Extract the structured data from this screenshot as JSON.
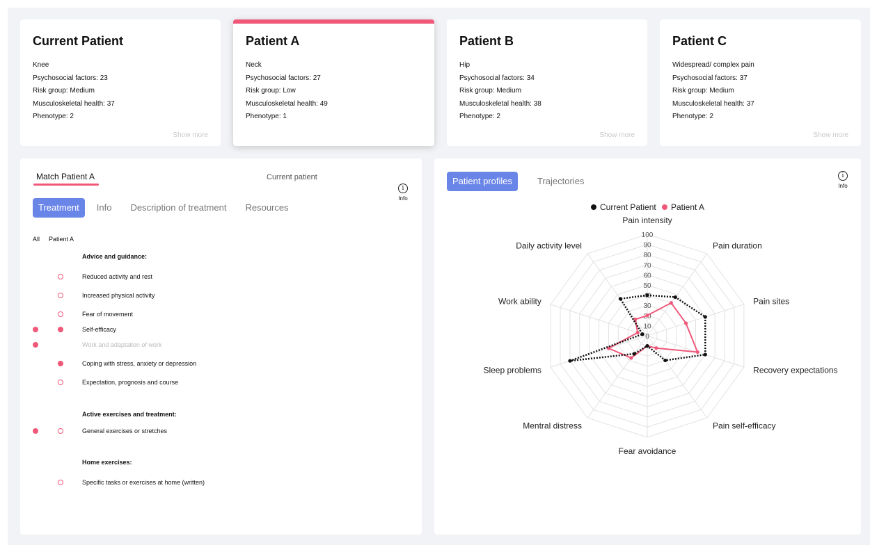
{
  "cards": [
    {
      "title": "Current Patient",
      "location": "Knee",
      "psychosocial": "Psychosocial factors: 23",
      "risk": "Risk group: Medium",
      "msk": "Musculoskeletal health: 37",
      "phenotype": "Phenotype: 2",
      "show_more": "Show more"
    },
    {
      "title": "Patient A",
      "location": "Neck",
      "psychosocial": "Psychosocial factors: 27",
      "risk": "Risk group: Low",
      "msk": "Musculoskeletal health: 49",
      "phenotype": "Phenotype: 1",
      "show_more": ""
    },
    {
      "title": "Patient B",
      "location": "Hip",
      "psychosocial": "Psychosocial factors: 34",
      "risk": "Risk group: Medium",
      "msk": "Musculoskeletal health: 38",
      "phenotype": "Phenotype: 2",
      "show_more": "Show more"
    },
    {
      "title": "Patient C",
      "location": "Widespread/ complex pain",
      "psychosocial": "Psychosocial factors: 37",
      "risk": "Risk group: Medium",
      "msk": "Musculoskeletal health: 37",
      "phenotype": "Phenotype: 2",
      "show_more": "Show more"
    }
  ],
  "left_panel": {
    "tab_match": "Match Patient A",
    "tab_current": "Current patient",
    "info_icon": "i",
    "info_label": "Info",
    "subtabs": [
      "Treatment",
      "Info",
      "Description of treatment",
      "Resources"
    ],
    "col_all": "All",
    "col_patient": "Patient A",
    "rows": [
      {
        "label": "Advice and guidance:",
        "section": true,
        "all": null,
        "patient": null
      },
      {
        "label": "Reduced activity and rest",
        "section": false,
        "all": null,
        "patient": "hollow"
      },
      {
        "label": "Increased physical activity",
        "section": false,
        "all": null,
        "patient": "hollow"
      },
      {
        "label": "Fear of movement",
        "section": false,
        "all": null,
        "patient": "hollow"
      },
      {
        "label": "Self-efficacy",
        "section": false,
        "all": "filled",
        "patient": "filled"
      },
      {
        "label": "Work and adaptation of work",
        "section": false,
        "muted": true,
        "all": "filled",
        "patient": null
      },
      {
        "label": "Coping with stress, anxiety or depression",
        "section": false,
        "all": null,
        "patient": "filled"
      },
      {
        "label": "Expectation, prognosis and course",
        "section": false,
        "all": null,
        "patient": "hollow"
      },
      {
        "label": "Active exercises and treatment:",
        "section": true,
        "all": null,
        "patient": null
      },
      {
        "label": "General exercises or stretches",
        "section": false,
        "all": "filled",
        "patient": "hollow"
      },
      {
        "label": "Home exercises:",
        "section": true,
        "all": null,
        "patient": null
      },
      {
        "label": "Specific tasks or exercises at home (written)",
        "section": false,
        "all": null,
        "patient": "hollow"
      }
    ]
  },
  "right_panel": {
    "tabs": [
      "Patient profiles",
      "Trajectories"
    ],
    "info_icon": "i",
    "info_label": "Info"
  },
  "colors": {
    "accent": "#6a85e8",
    "pink": "#f0587a",
    "current": "#111111"
  },
  "chart_data": {
    "type": "radar",
    "axes": [
      "Pain intensity",
      "Pain duration",
      "Pain sites",
      "Recovery expectations",
      "Pain self-efficacy",
      "Fear avoidance",
      "Mentral distress",
      "Sleep problems",
      "Work ability",
      "Daily activity level"
    ],
    "range": [
      0,
      100
    ],
    "ticks": [
      0,
      10,
      20,
      30,
      40,
      50,
      60,
      70,
      80,
      90,
      100
    ],
    "legend_position": "top",
    "series": [
      {
        "name": "Current Patient",
        "color": "#111111",
        "style": "dotted",
        "values": [
          40,
          47,
          60,
          60,
          30,
          10,
          22,
          80,
          5,
          45
        ]
      },
      {
        "name": "Patient A",
        "color": "#f0587a",
        "style": "solid",
        "values": [
          20,
          40,
          40,
          52,
          15,
          10,
          27,
          40,
          10,
          20
        ]
      }
    ]
  }
}
